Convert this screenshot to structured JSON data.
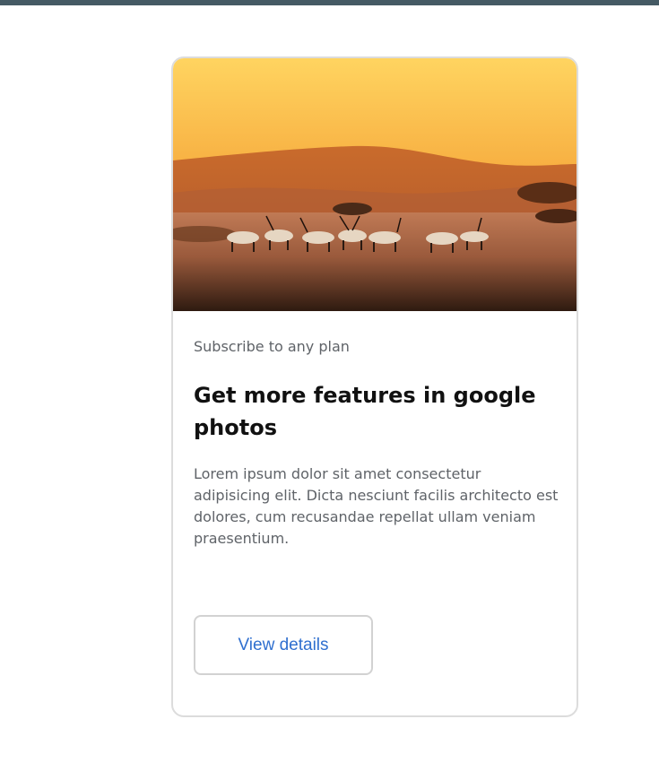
{
  "card": {
    "eyebrow": "Subscribe to any plan",
    "title": "Get more features in google photos",
    "description": "Lorem ipsum dolor sit amet consectetur adipisicing elit. Dicta nesciunt facilis architecto est dolores, cum recusandae repellat ullam veniam praesentium.",
    "button_label": "View details"
  },
  "colors": {
    "topbar": "#455a64",
    "button_text": "#2f6fcf",
    "body_text": "#5f6368",
    "title_text": "#111111"
  }
}
